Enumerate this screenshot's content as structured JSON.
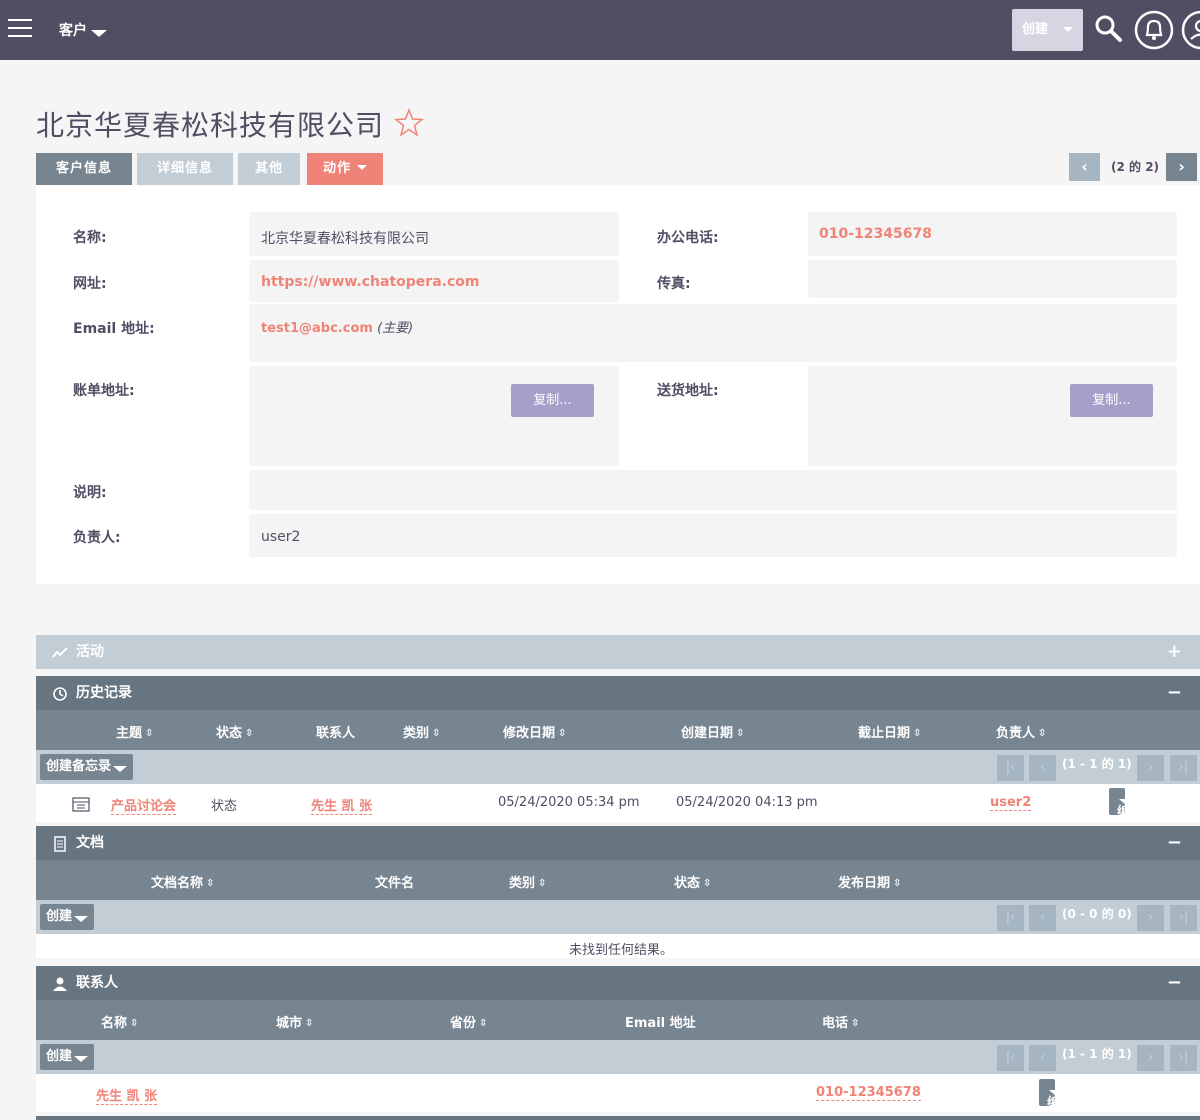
{
  "topbar": {
    "module_label": "客户",
    "create_label": "创建"
  },
  "page": {
    "title": "北京华夏春松科技有限公司"
  },
  "tabs": {
    "account_info": "客户信息",
    "detail_info": "详细信息",
    "other": "其他",
    "actions": "动作"
  },
  "pager": {
    "text": "(2 的 2)",
    "prev": "‹",
    "next": "›"
  },
  "detail": {
    "name_label": "名称:",
    "name_value": "北京华夏春松科技有限公司",
    "phone_label": "办公电话:",
    "phone_value": "010-12345678",
    "website_label": "网址:",
    "website_value": "https://www.chatopera.com",
    "fax_label": "传真:",
    "email_label": "Email 地址:",
    "email_value": "test1@abc.com",
    "email_primary": "(主要)",
    "billing_label": "账单地址:",
    "shipping_label": "送货地址:",
    "copy_label": "复制...",
    "description_label": "说明:",
    "assigned_label": "负责人:",
    "assigned_value": "user2"
  },
  "activities": {
    "title": "活动",
    "toggle": "+"
  },
  "history": {
    "title": "历史记录",
    "toggle": "−",
    "columns": [
      "主题",
      "状态",
      "联系人",
      "类别",
      "修改日期",
      "创建日期",
      "截止日期",
      "负责人"
    ],
    "create_note": "创建备忘录",
    "pager_text": "(1 - 1 的 1)",
    "row": {
      "subject": "产品讨论会",
      "status": "状态",
      "contact": "先生 凯 张",
      "modified": "05/24/2020 05:34 pm",
      "created": "05/24/2020 04:13 pm",
      "assigned": "user2",
      "edit": "编辑"
    }
  },
  "documents": {
    "title": "文档",
    "toggle": "−",
    "columns": [
      "文档名称",
      "文件名",
      "类别",
      "状态",
      "发布日期"
    ],
    "create": "创建",
    "pager_text": "(0 - 0 的 0)",
    "empty": "未找到任何结果。"
  },
  "contacts": {
    "title": "联系人",
    "toggle": "−",
    "columns": [
      "名称",
      "城市",
      "省份",
      "Email 地址",
      "电话"
    ],
    "create": "创建",
    "pager_text": "(1 - 1 的 1)",
    "row": {
      "name": "先生 凯 张",
      "phone": "010-12345678",
      "edit": "编辑"
    }
  },
  "colors": {
    "topbar": "#534d64",
    "accent": "#f08377",
    "subpanel_header": "#778591",
    "subpanel_tool": "#c2cdd5",
    "copy_button": "#a5a0c9"
  }
}
